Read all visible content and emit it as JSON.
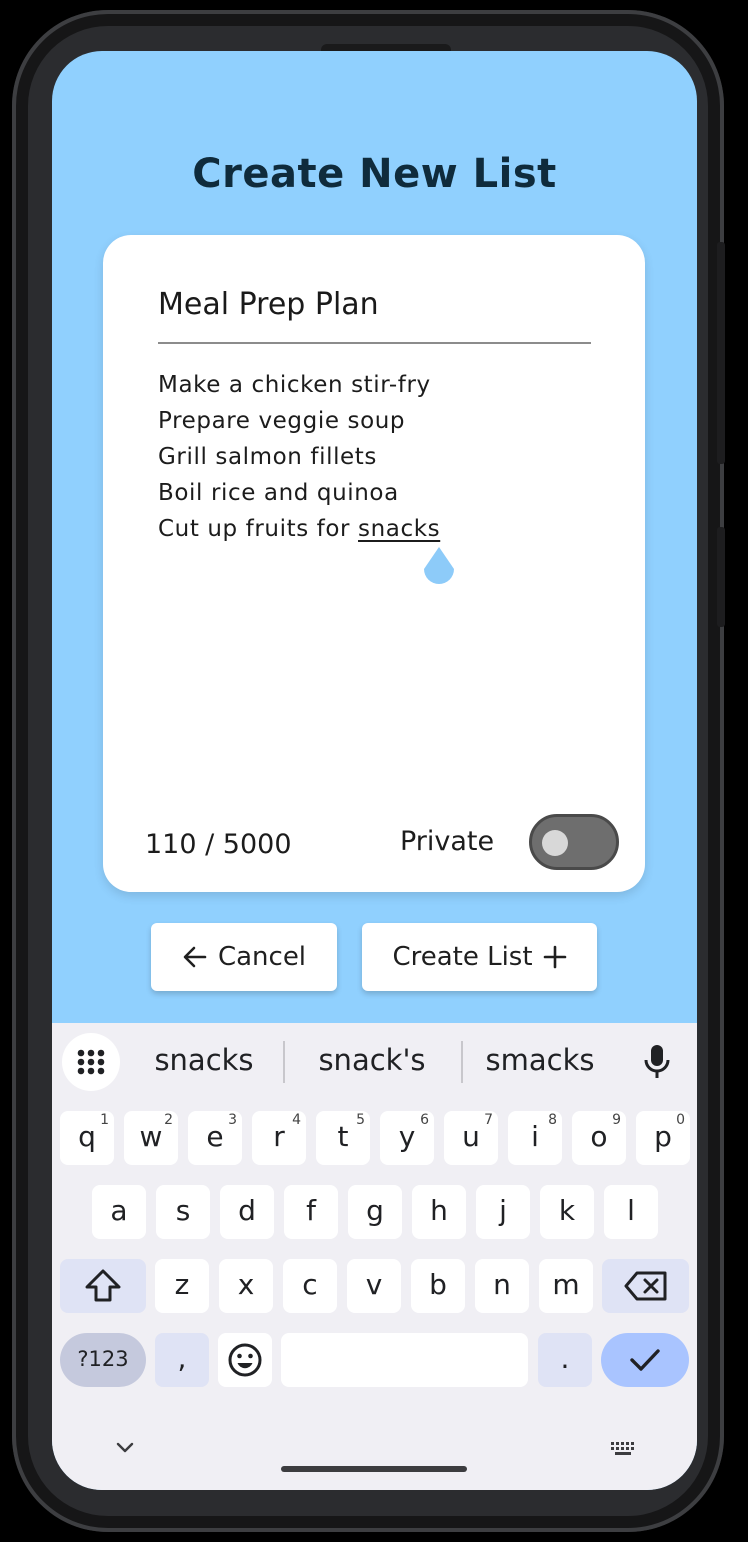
{
  "header": {
    "title": "Create New List"
  },
  "card": {
    "list_name": "Meal Prep Plan",
    "items": [
      "Make a chicken stir-fry",
      "Prepare veggie soup",
      "Grill salmon fillets",
      "Boil rice and quinoa"
    ],
    "last_item_prefix": "Cut up fruits for ",
    "last_item_word": "snacks",
    "counter": "110 / 5000",
    "private_label": "Private",
    "private_enabled": false
  },
  "actions": {
    "cancel_label": "Cancel",
    "create_label": "Create List"
  },
  "keyboard": {
    "suggestions": [
      "snacks",
      "snack's",
      "smacks"
    ],
    "row1": [
      {
        "k": "q",
        "n": "1"
      },
      {
        "k": "w",
        "n": "2"
      },
      {
        "k": "e",
        "n": "3"
      },
      {
        "k": "r",
        "n": "4"
      },
      {
        "k": "t",
        "n": "5"
      },
      {
        "k": "y",
        "n": "6"
      },
      {
        "k": "u",
        "n": "7"
      },
      {
        "k": "i",
        "n": "8"
      },
      {
        "k": "o",
        "n": "9"
      },
      {
        "k": "p",
        "n": "0"
      }
    ],
    "row2": [
      "a",
      "s",
      "d",
      "f",
      "g",
      "h",
      "j",
      "k",
      "l"
    ],
    "row3": [
      "z",
      "x",
      "c",
      "v",
      "b",
      "n",
      "m"
    ],
    "symbols_label": "?123",
    "comma_label": ",",
    "period_label": "."
  },
  "colors": {
    "background": "#90d0fe",
    "title": "#0f2b3c",
    "cursor_handle": "#8dcbf9",
    "enter_key": "#a9c4ff"
  }
}
